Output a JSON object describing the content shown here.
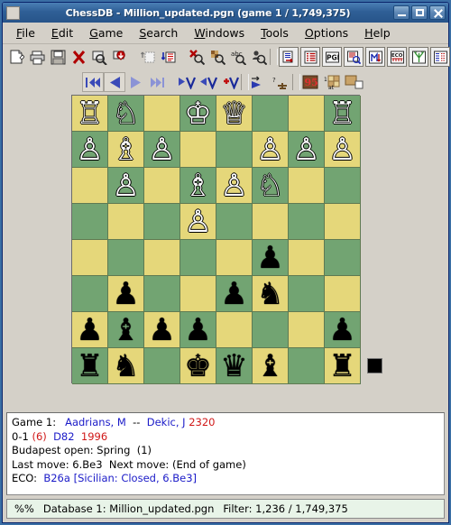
{
  "window": {
    "title": "ChessDB - Million_updated.pgn (game 1 / 1,749,375)",
    "minimize_label": "Minimize",
    "maximize_label": "Maximize",
    "close_label": "Close"
  },
  "menubar": {
    "items": [
      {
        "label": "File",
        "accel": "F"
      },
      {
        "label": "Edit",
        "accel": "E"
      },
      {
        "label": "Game",
        "accel": "G"
      },
      {
        "label": "Search",
        "accel": "S"
      },
      {
        "label": "Windows",
        "accel": "W"
      },
      {
        "label": "Tools",
        "accel": "T"
      },
      {
        "label": "Options",
        "accel": "O"
      },
      {
        "label": "Help",
        "accel": "H"
      }
    ]
  },
  "toolbar_main": {
    "items": [
      {
        "name": "new-database-icon",
        "title": "New"
      },
      {
        "name": "open-database-icon",
        "title": "Open"
      },
      {
        "name": "save-database-icon",
        "title": "Save"
      },
      {
        "name": "close-database-icon",
        "title": "Close"
      },
      {
        "name": "find-game-icon",
        "title": "Find game"
      },
      {
        "name": "import-game-icon",
        "title": "Import"
      },
      {
        "name": "previous-filter-icon",
        "title": "Previous"
      },
      {
        "name": "next-filter-icon",
        "title": "Next"
      },
      {
        "name": "reset-filter-icon",
        "title": "Reset filter"
      },
      {
        "name": "board-search-icon",
        "title": "Board search"
      },
      {
        "name": "header-search-icon",
        "title": "Header search"
      },
      {
        "name": "player-search-icon",
        "title": "Player search"
      },
      {
        "name": "game-list-icon",
        "title": "Game list"
      },
      {
        "name": "player-list-icon",
        "title": "Player list"
      },
      {
        "name": "pgn-window-icon",
        "title": "PGN"
      },
      {
        "name": "game-info-icon",
        "title": "Game info"
      },
      {
        "name": "opening-report-icon",
        "title": "Opening report"
      },
      {
        "name": "eco-browser-icon",
        "title": "ECO"
      },
      {
        "name": "tree-window-icon",
        "title": "Tree"
      },
      {
        "name": "crosstable-icon",
        "title": "Crosstable"
      },
      {
        "name": "engine-icon",
        "title": "Engine"
      }
    ]
  },
  "toolbar_nav": {
    "items": [
      {
        "name": "first-move-button",
        "title": "Start"
      },
      {
        "name": "previous-move-button",
        "title": "Back"
      },
      {
        "name": "next-move-button",
        "title": "Forward"
      },
      {
        "name": "last-move-button",
        "title": "End"
      },
      {
        "name": "enter-variation-button",
        "title": "Enter variation"
      },
      {
        "name": "exit-variation-button",
        "title": "Exit variation"
      },
      {
        "name": "add-variation-button",
        "title": "Add variation"
      },
      {
        "name": "autoplay-button",
        "title": "Autoplay"
      },
      {
        "name": "flip-board-button",
        "title": "Flip board"
      },
      {
        "name": "piece-style-button",
        "title": "Piece style"
      },
      {
        "name": "coords-button",
        "title": "Coordinates"
      },
      {
        "name": "board-colors-button",
        "title": "Board colors"
      }
    ]
  },
  "board": {
    "light_square_color": "#e5d77a",
    "dark_square_color": "#72a472",
    "side_to_move": "black",
    "side_to_move_indicator_color": "#000000",
    "ranks": [
      [
        "wR",
        "wN",
        "",
        "wK",
        "wQ",
        "",
        "",
        "wR"
      ],
      [
        "wP",
        "wB",
        "wP",
        "",
        "",
        "wP",
        "wP",
        "wP"
      ],
      [
        "",
        "wP",
        "",
        "wB",
        "wP",
        "wN",
        "",
        ""
      ],
      [
        "",
        "",
        "",
        "wP",
        "",
        "",
        "",
        ""
      ],
      [
        "",
        "",
        "",
        "",
        "",
        "bP",
        "",
        ""
      ],
      [
        "",
        "bP",
        "",
        "",
        "bP",
        "bN",
        "",
        ""
      ],
      [
        "bP",
        "bB",
        "bP",
        "bP",
        "",
        "",
        "",
        "bP"
      ],
      [
        "bR",
        "bN",
        "",
        "bK",
        "bQ",
        "bB",
        "",
        "bR"
      ]
    ]
  },
  "game_info": {
    "line1": {
      "label": "Game 1:",
      "white": "Aadrians, M",
      "dash": "--",
      "black": "Dekic, J",
      "black_rating": "2320"
    },
    "line2": {
      "result": "0-1",
      "moves": "(6)",
      "eco_code": "D82",
      "year": "1996"
    },
    "line3": {
      "event": "Budapest open:  Spring",
      "round": "(1)"
    },
    "line4": {
      "last_move_label": "Last move:",
      "last_move": "6.Be3",
      "next_move_label": "Next move:",
      "next_move": "(End of game)"
    },
    "line5": {
      "label": "ECO:",
      "code": "B26a",
      "description": "[Sicilian: Closed, 6.Be3]"
    }
  },
  "statusbar": {
    "prefix": "%%",
    "database_label": "Database 1: Million_updated.pgn",
    "filter_label": "Filter: 1,236 / 1,749,375"
  }
}
